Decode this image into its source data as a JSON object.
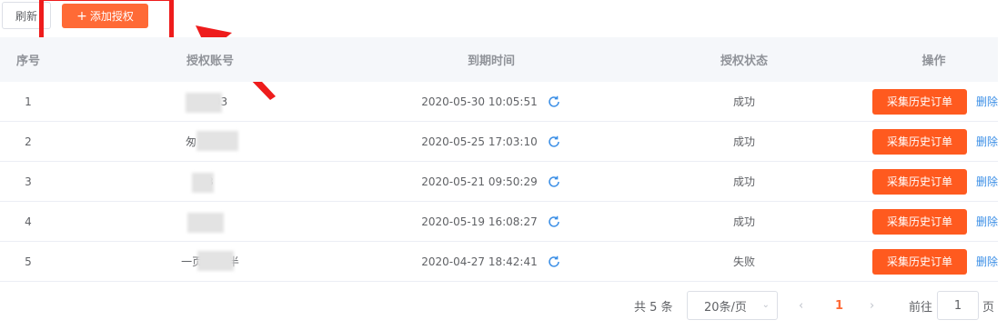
{
  "toolbar": {
    "refresh_label": "刷新",
    "add_label": "添加授权",
    "add_icon": "plus-icon"
  },
  "colors": {
    "accent": "#ff6a36",
    "collect_button": "#ff5a1f",
    "highlight": "#ee1c1c",
    "link": "#3a8ee6"
  },
  "table": {
    "headers": {
      "index": "序号",
      "account": "授权账号",
      "expire": "到期时间",
      "status": "授权状态",
      "ops": "操作"
    },
    "rows": [
      {
        "index": "1",
        "account": "27903",
        "expire": "2020-05-30 10:05:51",
        "status": "成功",
        "collect": "采集历史订单",
        "delete": "删除"
      },
      {
        "index": "2",
        "account": "匆 99999",
        "expire": "2020-05-25 17:03:10",
        "status": "成功",
        "collect": "采集历史订单",
        "delete": "删除"
      },
      {
        "index": "3",
        "account": "3",
        "expire": "2020-05-21 09:50:29",
        "status": "成功",
        "collect": "采集历史订单",
        "delete": "删除"
      },
      {
        "index": "4",
        "account": "ve",
        "expire": "2020-05-19 16:08:27",
        "status": "成功",
        "collect": "采集历史订单",
        "delete": "删除"
      },
      {
        "index": "5",
        "account": "一页 局下半",
        "expire": "2020-04-27 18:42:41",
        "status": "失败",
        "collect": "采集历史订单",
        "delete": "删除"
      }
    ],
    "refresh_icon": "refresh-icon"
  },
  "pagination": {
    "total": "共 5 条",
    "page_size": "20条/页",
    "current_page": "1",
    "goto_label": "前往",
    "goto_value": "1",
    "goto_unit": "页"
  }
}
